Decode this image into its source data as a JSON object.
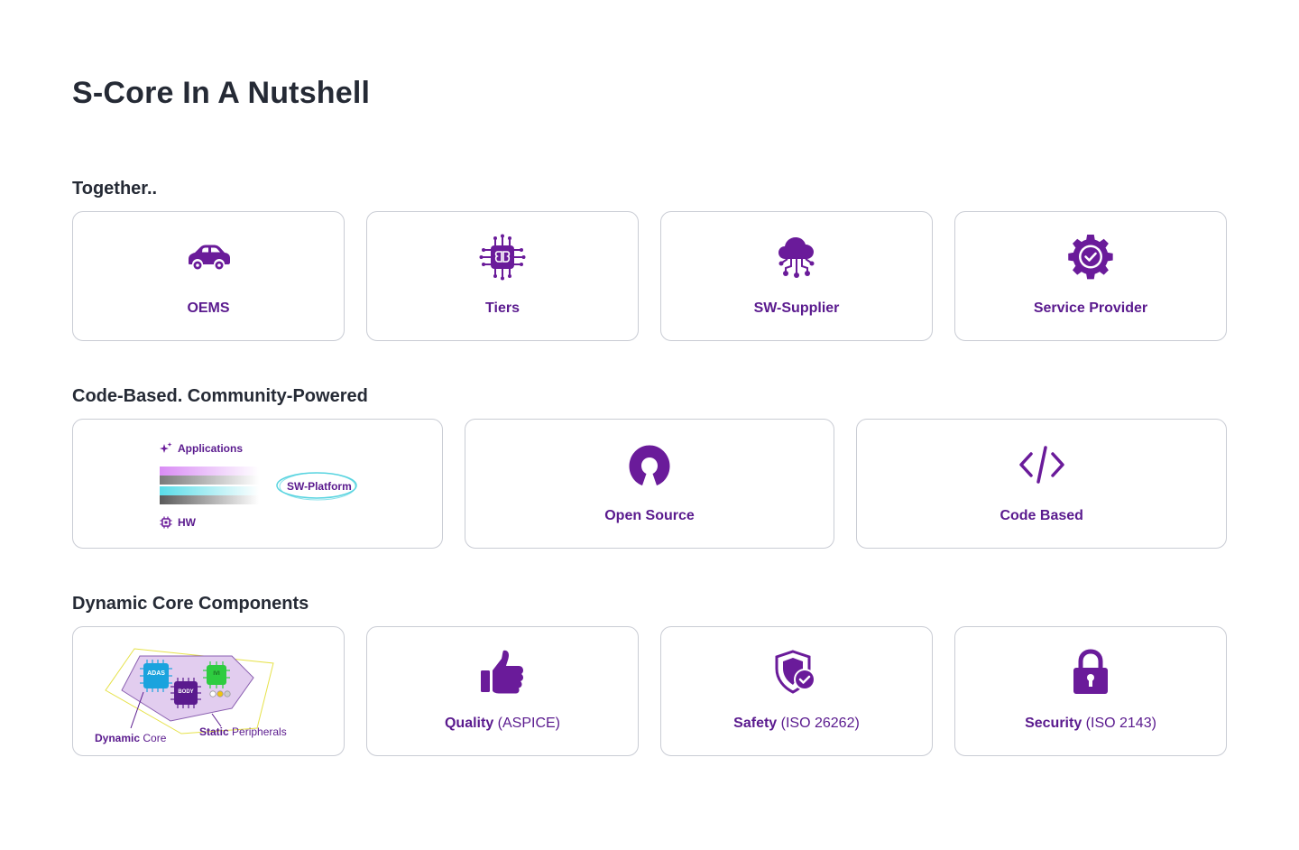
{
  "page": {
    "title": "S-Core In A Nutshell"
  },
  "sections": {
    "together": {
      "title": "Together..",
      "cards": [
        {
          "label": "OEMS",
          "icon": "car-icon"
        },
        {
          "label": "Tiers",
          "icon": "chip-brain-icon"
        },
        {
          "label": "SW-Supplier",
          "icon": "cloud-network-icon"
        },
        {
          "label": "Service Provider",
          "icon": "gear-check-icon"
        }
      ]
    },
    "code": {
      "title": "Code-Based. Community-Powered",
      "platform": {
        "applications": "Applications",
        "sw_platform": "SW-Platform",
        "hw": "HW"
      },
      "cards": [
        {
          "label": "Open Source",
          "icon": "open-source-icon"
        },
        {
          "label": "Code Based",
          "icon": "code-icon"
        }
      ]
    },
    "dynamic": {
      "title": "Dynamic Core Components",
      "diagram": {
        "adas": "ADAS",
        "body": "BODY",
        "ivi": "IVI",
        "dynamic_bold": "Dynamic",
        "dynamic_rest": " Core",
        "static_bold": "Static",
        "static_rest": " Peripherals"
      },
      "cards": [
        {
          "label": "Quality",
          "sub": " (ASPICE)",
          "icon": "thumbs-up-icon"
        },
        {
          "label": "Safety",
          "sub": " (ISO 26262)",
          "icon": "shield-check-icon"
        },
        {
          "label": "Security",
          "sub": " (ISO 2143)",
          "icon": "lock-icon"
        }
      ]
    }
  },
  "colors": {
    "accent": "#6a1b9a",
    "border": "#c9ccd4",
    "heading": "#252a35"
  }
}
